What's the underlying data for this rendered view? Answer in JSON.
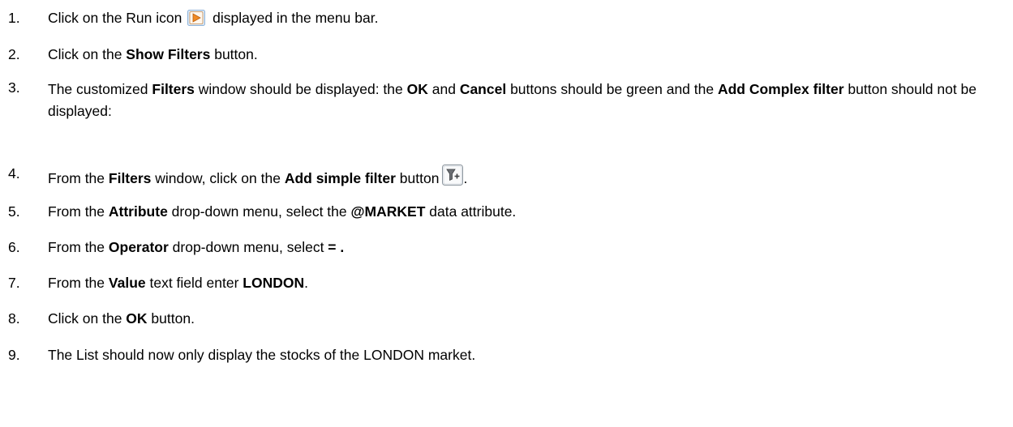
{
  "steps": [
    {
      "num": "1.",
      "parts": [
        "Click on the Run icon",
        "displayed in the menu bar."
      ]
    },
    {
      "num": "2.",
      "parts": [
        "Click on the ",
        "Show Filters",
        " button."
      ]
    },
    {
      "num": "3.",
      "parts": [
        "The customized ",
        "Filters",
        " window should be displayed: the ",
        "OK",
        " and ",
        "Cancel",
        " buttons should be green and the ",
        "Add Complex filter",
        " button should not be displayed:"
      ]
    },
    {
      "num": "4.",
      "parts": [
        "From the ",
        "Filters",
        " window, click on the ",
        "Add simple filter",
        " button",
        "."
      ]
    },
    {
      "num": "5.",
      "parts": [
        "From the ",
        "Attribute",
        " drop-down menu, select the ",
        "@MARKET",
        " data attribute."
      ]
    },
    {
      "num": "6.",
      "parts": [
        "From the ",
        "Operator",
        " drop-down menu, select ",
        "= ."
      ]
    },
    {
      "num": "7.",
      "parts": [
        "From the ",
        "Value",
        " text field enter ",
        "LONDON",
        "."
      ]
    },
    {
      "num": "8.",
      "parts": [
        "Click on the ",
        "OK",
        " button."
      ]
    },
    {
      "num": "9.",
      "parts": [
        "The List should now only display the stocks of the LONDON market."
      ]
    }
  ],
  "icons": {
    "run": "run-icon",
    "filter": "add-simple-filter-icon"
  },
  "colors": {
    "run_icon_fill": "#f08a24",
    "run_icon_bg": "#dbe9f7",
    "filter_icon_bg": "#eef1f4"
  }
}
